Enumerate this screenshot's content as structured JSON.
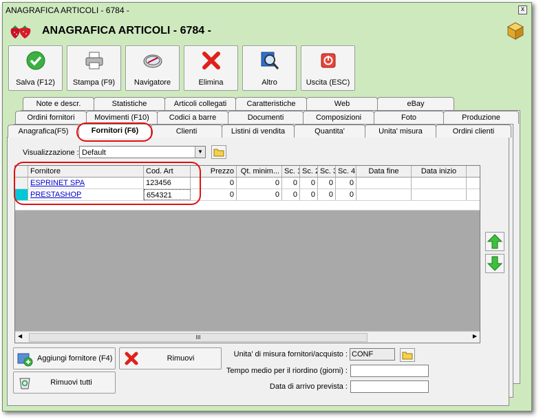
{
  "window": {
    "title": "ANAGRAFICA ARTICOLI - 6784 -",
    "close_label": "x"
  },
  "header": {
    "title": "ANAGRAFICA ARTICOLI - 6784 -"
  },
  "toolbar": {
    "buttons": [
      {
        "label": "Salva (F12)",
        "icon": "checkmark-icon"
      },
      {
        "label": "Stampa (F9)",
        "icon": "printer-icon"
      },
      {
        "label": "Navigatore",
        "icon": "compass-icon"
      },
      {
        "label": "Elimina",
        "icon": "delete-x-icon"
      },
      {
        "label": "Altro",
        "icon": "magnifier-icon"
      },
      {
        "label": "Uscita (ESC)",
        "icon": "exit-icon"
      }
    ]
  },
  "tabs": {
    "row1": [
      "Note e descr.",
      "Statistiche",
      "Articoli collegati",
      "Caratteristiche",
      "Web",
      "eBay"
    ],
    "row2": [
      "Ordini fornitori",
      "Movimenti (F10)",
      "Codici a barre",
      "Documenti",
      "Composizioni",
      "Foto",
      "Produzione"
    ],
    "row3": [
      "Anagrafica(F5)",
      "Fornitori (F6)",
      "Clienti",
      "Listini di vendita",
      "Quantita'",
      "Unita' misura",
      "Ordini clienti"
    ]
  },
  "view": {
    "label": "Visualizzazione :",
    "value": "Default"
  },
  "grid": {
    "columns": [
      "Fornitore",
      "Cod. Art",
      "Prezzo",
      "Qt. minim...",
      "Sc. 1",
      "Sc. 2",
      "Sc. 3",
      "Sc. 4",
      "Data fine",
      "Data inizio"
    ],
    "rows": [
      {
        "fornitore": "ESPRINET SPA",
        "cod": "123456",
        "prezzo": "0",
        "qt": "0",
        "sc1": "0",
        "sc2": "0",
        "sc3": "0",
        "sc4": "0",
        "fine": "",
        "inizio": ""
      },
      {
        "fornitore": "PRESTASHOP",
        "cod": "654321",
        "prezzo": "0",
        "qt": "0",
        "sc1": "0",
        "sc2": "0",
        "sc3": "0",
        "sc4": "0",
        "fine": "",
        "inizio": ""
      }
    ],
    "scroll_grip": "III"
  },
  "actions": {
    "add_supplier": "Aggiungi fornitore (F4)",
    "remove": "Rimuovi",
    "remove_all": "Rimuovi tutti"
  },
  "fields": {
    "unit_label": "Unita' di misura fornitori/acquisto :",
    "unit_value": "CONF",
    "lead_time_label": "Tempo medio per il riordino (giorni) :",
    "lead_time_value": "",
    "arrival_label": "Data di arrivo prevista :",
    "arrival_value": ""
  },
  "colors": {
    "window_bg": "#cfe9bf",
    "highlight": "#e01010",
    "link": "#0000cc",
    "row_marker": "#00c8d8"
  }
}
